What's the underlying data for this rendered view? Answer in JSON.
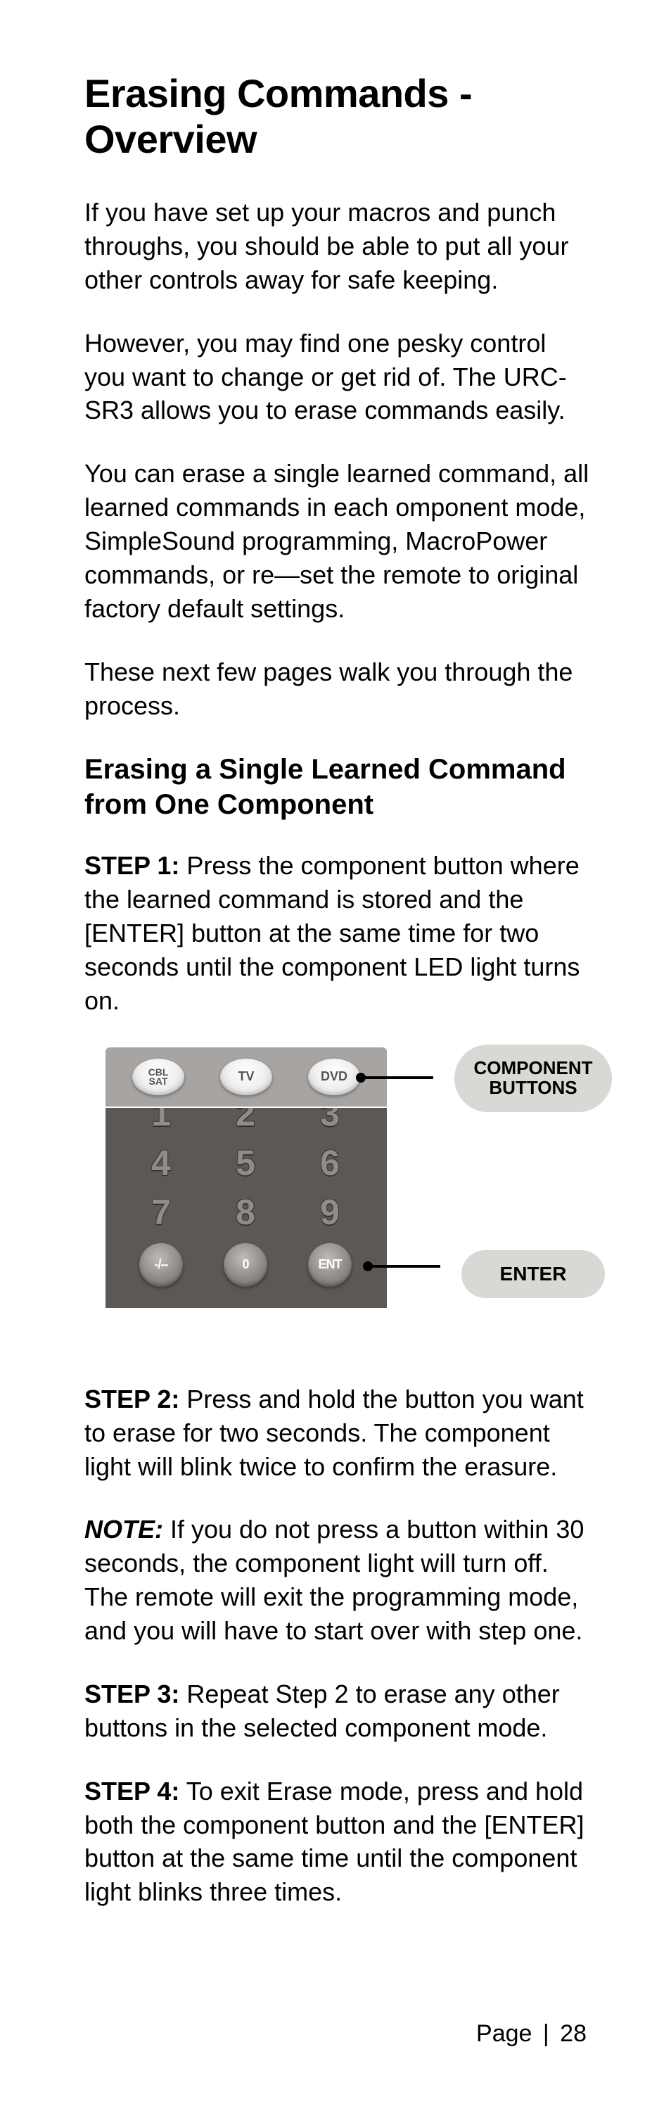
{
  "title": "Erasing Commands - Overview",
  "paragraphs": {
    "p1": "If you have set up your macros and punch throughs, you should be able to put all your other controls away for safe keeping.",
    "p2": "However, you may find one pesky control you want to change or get rid of.  The URC- SR3 allows you to erase commands easily.",
    "p3": "You can erase a single learned command, all learned commands in each omponent mode, SimpleSound programming, MacroPower commands, or re—set the remote to original factory default settings.",
    "p4": "These next few pages walk you through the process."
  },
  "subhead": "Erasing a Single Learned Command from One Component",
  "steps": {
    "s1_label": "STEP 1:",
    "s1_text": " Press the component button where the learned command is stored and the [ENTER] button at the same time for two seconds until the component LED light turns on.",
    "s2_label": "STEP 2:",
    "s2_text": " Press and hold the button you want to erase for two seconds. The component light will blink twice to confirm the erasure.",
    "note_label": "NOTE:",
    "note_text": " If you do not press a button within 30 seconds, the component light will turn off. The remote will exit the programming mode, and you will have to start over with step one.",
    "s3_label": "STEP 3:",
    "s3_text": " Repeat Step 2 to erase any other buttons in the selected component mode.",
    "s4_label": "STEP 4:",
    "s4_text": " To exit Erase mode, press and hold both the component button and the [ENTER] button at the same time until the component light blinks three times."
  },
  "remote": {
    "comp_buttons": {
      "cbl": "CBL\nSAT",
      "tv": "TV",
      "dvd": "DVD"
    },
    "digits": {
      "d1": "1",
      "d2": "2",
      "d3": "3",
      "d4": "4",
      "d5": "5",
      "d6": "6",
      "d7": "7",
      "d8": "8",
      "d9": "9",
      "d0": "0"
    },
    "dash_btn": "-/--",
    "ent_btn": "ENT",
    "callout_component": "COMPONENT BUTTONS",
    "callout_enter": "ENTER"
  },
  "footer": {
    "page_word": "Page",
    "sep": "|",
    "num": "28"
  }
}
